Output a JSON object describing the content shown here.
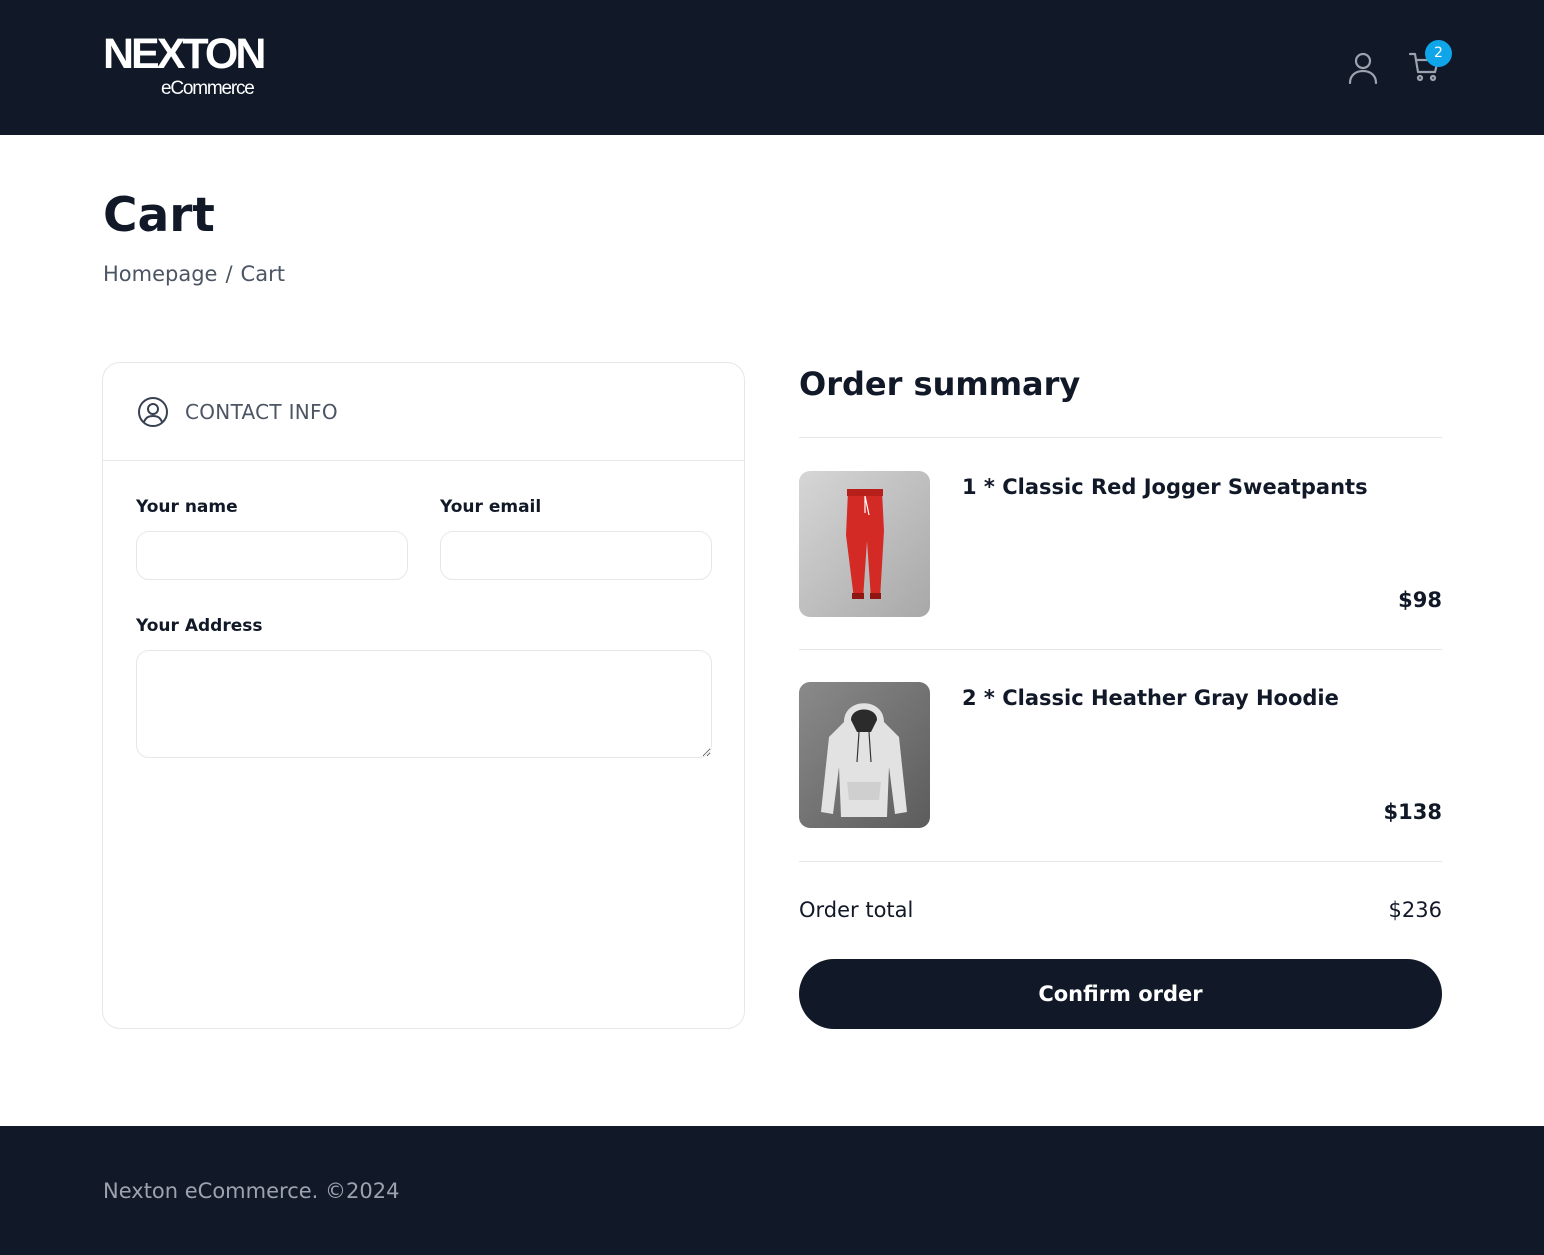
{
  "header": {
    "logo_main": "NEXTON",
    "logo_sub": "eCommerce",
    "cart_count": "2"
  },
  "page": {
    "title": "Cart",
    "breadcrumb": {
      "home": "Homepage",
      "separator": "/",
      "current": "Cart"
    }
  },
  "contact": {
    "title": "CONTACT INFO",
    "name_label": "Your name",
    "name_value": "",
    "email_label": "Your email",
    "email_value": "",
    "address_label": "Your Address",
    "address_value": ""
  },
  "summary": {
    "title": "Order summary",
    "items": [
      {
        "name": "1 * Classic Red Jogger Sweatpants",
        "price": "$98",
        "image": "red-jogger-sweatpants-image"
      },
      {
        "name": "2 * Classic Heather Gray Hoodie",
        "price": "$138",
        "image": "gray-hoodie-image"
      }
    ],
    "total_label": "Order total",
    "total_value": "$236",
    "confirm_label": "Confirm order"
  },
  "footer": {
    "text": "Nexton eCommerce. ©2024"
  },
  "colors": {
    "dark": "#111827",
    "badge": "#0ea5e9",
    "border": "#e5e7eb",
    "muted_text": "#4b5563"
  }
}
